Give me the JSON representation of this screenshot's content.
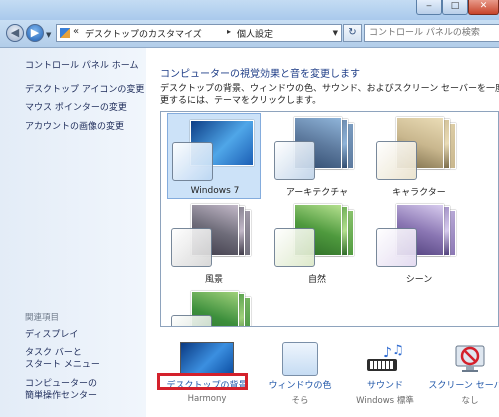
{
  "window": {
    "controls": {
      "minimize": "‒",
      "maximize": "□",
      "close": "✕"
    }
  },
  "nav": {
    "back": "◀",
    "forward": "▶",
    "address": {
      "prefix": "«",
      "crumbs": [
        "デスクトップのカスタマイズ",
        "個人設定"
      ],
      "separator": "▸"
    },
    "refresh": "↻",
    "search_placeholder": "コントロール パネルの検索"
  },
  "sidebar": {
    "links": [
      "コントロール パネル ホーム",
      "デスクトップ アイコンの変更",
      "マウス ポインターの変更",
      "アカウントの画像の変更"
    ],
    "related_heading": "関連項目",
    "related": [
      {
        "lines": [
          "ディスプレイ"
        ]
      },
      {
        "lines": [
          "タスク バーと",
          "スタート メニュー"
        ]
      },
      {
        "lines": [
          "コンピューターの",
          "簡単操作センター"
        ]
      }
    ]
  },
  "main": {
    "title": "コンピューターの視覚効果と音を変更します",
    "description_lines": [
      "デスクトップの背景、ウィンドウの色、サウンド、およびスクリーン セーバーを一度に変",
      "更するには、テーマをクリックします。"
    ],
    "themes": [
      {
        "label": "Windows 7",
        "selected": true,
        "colors": [
          "#1c5fb5",
          "#4fa6e8",
          "#0e3e86"
        ],
        "glass": "#bcd7f3"
      },
      {
        "label": "アーキテクチャ",
        "selected": false,
        "colors": [
          "#5d7a9e",
          "#8fb4d9",
          "#2f4a6e"
        ],
        "glass": "#bfd3e9"
      },
      {
        "label": "キャラクター",
        "selected": false,
        "colors": [
          "#c9b78e",
          "#eadcb6",
          "#7a6b48"
        ],
        "glass": "#eae2cc"
      },
      {
        "label": "風景",
        "selected": false,
        "colors": [
          "#6f6d7a",
          "#c2b8c8",
          "#3e3a48"
        ],
        "glass": "#d6d6d6"
      },
      {
        "label": "自然",
        "selected": false,
        "colors": [
          "#4f9a3e",
          "#b4e08e",
          "#2c6a26"
        ],
        "glass": "#dbe8c7"
      },
      {
        "label": "シーン",
        "selected": false,
        "colors": [
          "#8a76b3",
          "#d7cbee",
          "#4e3e7a"
        ],
        "glass": "#e2d9f0"
      },
      {
        "label": "",
        "selected": false,
        "colors": [
          "#3c8f3c",
          "#9fd07a",
          "#2d6b2d"
        ],
        "glass": "#c9d8c9"
      }
    ],
    "options": [
      {
        "link": "デスクトップの背景",
        "sub": "Harmony",
        "icon": "desktop-background-icon"
      },
      {
        "link": "ウィンドウの色",
        "sub": "そら",
        "icon": "window-color-icon"
      },
      {
        "link": "サウンド",
        "sub": "Windows 標準",
        "icon": "sound-icon"
      },
      {
        "link": "スクリーン セーバー",
        "sub": "なし",
        "icon": "screen-saver-icon"
      }
    ]
  },
  "colors": {
    "link": "#1e55a8",
    "title": "#1e3d87",
    "highlight": "#d4212c",
    "selected_bg": "#cce2f8"
  }
}
